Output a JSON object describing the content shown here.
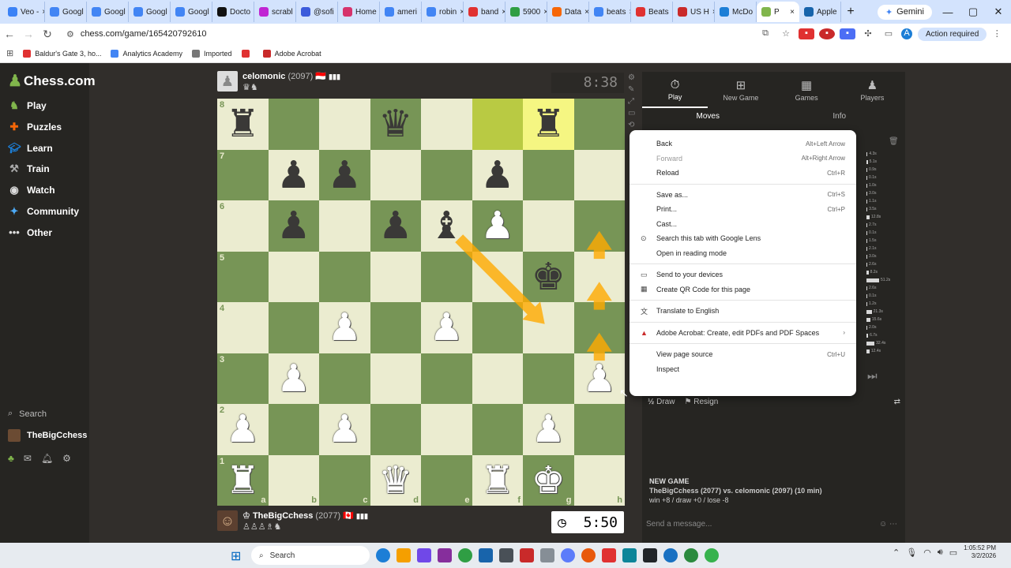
{
  "browser": {
    "tabs": [
      {
        "label": "Veo -",
        "color": "#3b82f6"
      },
      {
        "label": "Googl",
        "color": "#4285f4"
      },
      {
        "label": "Googl",
        "color": "#4285f4"
      },
      {
        "label": "Googl",
        "color": "#4285f4"
      },
      {
        "label": "Googl",
        "color": "#4285f4"
      },
      {
        "label": "Docto",
        "color": "#111111"
      },
      {
        "label": "scrabl",
        "color": "#c026d3"
      },
      {
        "label": "@sofi",
        "color": "#3b5bdb"
      },
      {
        "label": "Home",
        "color": "#d6336c"
      },
      {
        "label": "ameri",
        "color": "#4285f4"
      },
      {
        "label": "robin",
        "color": "#4285f4"
      },
      {
        "label": "band",
        "color": "#e03131"
      },
      {
        "label": "5900",
        "color": "#2f9e44"
      },
      {
        "label": "Data",
        "color": "#f76707"
      },
      {
        "label": "beats",
        "color": "#4285f4"
      },
      {
        "label": "Beats",
        "color": "#e03131"
      },
      {
        "label": "US H",
        "color": "#c92a2a"
      },
      {
        "label": "McDo",
        "color": "#1c7ed6"
      },
      {
        "label": "P",
        "color": "#81b64c",
        "active": true
      },
      {
        "label": "Apple",
        "color": "#1864ab"
      }
    ],
    "new_tab": "+",
    "gemini_label": "Gemini",
    "url": "chess.com/game/165420792610",
    "action_required": "Action required",
    "bookmarks": [
      {
        "label": "Baldur's Gate 3, ho...",
        "color": "#e03131"
      },
      {
        "label": "Analytics Academy",
        "color": "#4285f4"
      },
      {
        "label": "Imported",
        "color": "#777777"
      },
      {
        "label": "",
        "color": "#e03131"
      },
      {
        "label": "Adobe Acrobat",
        "color": "#c92a2a"
      }
    ]
  },
  "sidebar": {
    "logo": "Chess.com",
    "nav": [
      {
        "label": "Play",
        "icon": "play-icon",
        "color": "#81b64c"
      },
      {
        "label": "Puzzles",
        "icon": "puzzle-icon",
        "color": "#f76707"
      },
      {
        "label": "Learn",
        "icon": "learn-icon",
        "color": "#1c7ed6"
      },
      {
        "label": "Train",
        "icon": "train-icon",
        "color": "#aaaaaa"
      },
      {
        "label": "Watch",
        "icon": "watch-icon",
        "color": "#dddddd"
      },
      {
        "label": "Community",
        "icon": "community-icon",
        "color": "#4dabf7"
      },
      {
        "label": "Other",
        "icon": "other-icon",
        "color": "#dddddd"
      }
    ],
    "search": "Search",
    "username": "TheBigCchess"
  },
  "game": {
    "top_player": {
      "name": "celomonic",
      "rating": "(2097)",
      "flag": "🇮🇩",
      "captured": "♛♞",
      "clock": "8:38"
    },
    "bottom_player": {
      "name": "TheBigCchess",
      "rating": "(2077)",
      "flag": "🇨🇦",
      "captured": "♙♙♙♗♞",
      "clock": "5:50"
    },
    "board": [
      [
        "bR",
        "",
        "",
        "bQ",
        "",
        "",
        "bR",
        ""
      ],
      [
        "",
        "bP",
        "bP",
        "",
        "",
        "bP",
        "",
        ""
      ],
      [
        "",
        "bP",
        "",
        "bP",
        "bB",
        "wP",
        "",
        ""
      ],
      [
        "",
        "",
        "",
        "",
        "",
        "",
        "bK",
        ""
      ],
      [
        "",
        "",
        "wP",
        "",
        "wP",
        "",
        "",
        ""
      ],
      [
        "",
        "wP",
        "",
        "",
        "",
        "",
        "",
        "wP"
      ],
      [
        "wP",
        "",
        "wP",
        "",
        "",
        "",
        "wP",
        ""
      ],
      [
        "wR",
        "",
        "",
        "wQ",
        "",
        "wR",
        "wK",
        ""
      ]
    ],
    "highlights": [
      "f8",
      "g8"
    ],
    "arrows": [
      {
        "from": "e6",
        "to": "g4"
      },
      {
        "from": "h3",
        "to": "h4"
      },
      {
        "from": "h4",
        "to": "h5"
      },
      {
        "from": "h5",
        "to": "h6"
      }
    ],
    "ranks": [
      "8",
      "7",
      "6",
      "5",
      "4",
      "3",
      "2",
      "1"
    ],
    "files": [
      "a",
      "b",
      "c",
      "d",
      "e",
      "f",
      "g",
      "h"
    ]
  },
  "panel": {
    "tabs": [
      {
        "label": "Play",
        "icon": "stopwatch-icon",
        "active": true
      },
      {
        "label": "New Game",
        "icon": "plus-icon"
      },
      {
        "label": "Games",
        "icon": "games-icon"
      },
      {
        "label": "Players",
        "icon": "players-icon"
      }
    ],
    "subtabs": [
      "Moves",
      "Info"
    ],
    "times": [
      "4.3s",
      "5.1s",
      "0.9s",
      "0.1s",
      "1.0s",
      "3.0s",
      "1.1s",
      "3.5s",
      "12.8s",
      "2.7s",
      "0.1s",
      "1.5s",
      "2.1s",
      "3.0s",
      "2.6s",
      "8.2s",
      "51.2s",
      "2.6s",
      "0.1s",
      "1.2s",
      "21.3s",
      "15.6s",
      "2.0s",
      "6.7s",
      "32.4s",
      "12.4s"
    ],
    "draw": "Draw",
    "draw_icon": "½",
    "resign": "Resign",
    "new_game_heading": "NEW GAME",
    "new_game_line": "TheBigCchess (2077) vs. celomonic (2097) (10 min)",
    "new_game_record": "win +8 / draw +0 / lose -8",
    "message_placeholder": "Send a message..."
  },
  "context_menu": {
    "groups": [
      [
        {
          "label": "Back",
          "shortcut": "Alt+Left Arrow"
        },
        {
          "label": "Forward",
          "shortcut": "Alt+Right Arrow",
          "disabled": true
        },
        {
          "label": "Reload",
          "shortcut": "Ctrl+R"
        }
      ],
      [
        {
          "label": "Save as...",
          "shortcut": "Ctrl+S"
        },
        {
          "label": "Print...",
          "shortcut": "Ctrl+P"
        },
        {
          "label": "Cast..."
        },
        {
          "label": "Search this tab with Google Lens",
          "icon": "lens-icon"
        },
        {
          "label": "Open in reading mode"
        }
      ],
      [
        {
          "label": "Send to your devices",
          "icon": "devices-icon"
        },
        {
          "label": "Create QR Code for this page",
          "icon": "qr-icon"
        }
      ],
      [
        {
          "label": "Translate to English",
          "icon": "translate-icon"
        }
      ],
      [
        {
          "label": "Adobe Acrobat: Create, edit PDFs and PDF Spaces",
          "icon": "acrobat-icon",
          "submenu": true
        }
      ],
      [
        {
          "label": "View page source",
          "shortcut": "Ctrl+U"
        },
        {
          "label": "Inspect"
        }
      ]
    ]
  },
  "taskbar": {
    "search": "Search",
    "time": "1:05:52 PM",
    "date": "3/2/2026"
  }
}
